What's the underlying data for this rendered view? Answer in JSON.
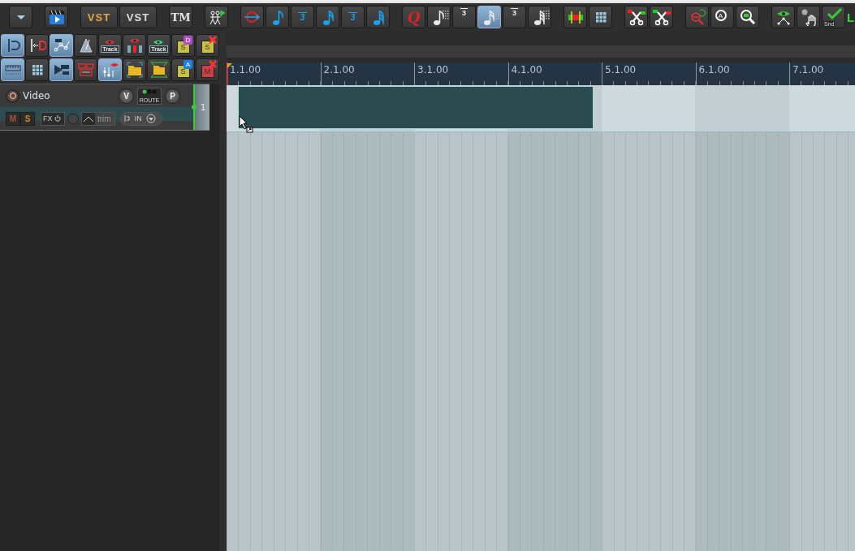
{
  "top_toolbar": {
    "groups": [
      [
        {
          "kind": "dropdown",
          "selected": false
        }
      ],
      [
        {
          "kind": "clapper",
          "selected": false
        }
      ],
      [
        {
          "kind": "text",
          "label": "VST",
          "color": "#e8a445",
          "selected": false
        },
        {
          "kind": "text",
          "label": "VST",
          "color": "#dcdcdc",
          "selected": false
        }
      ],
      [
        {
          "kind": "serif-text",
          "label": "TM",
          "color": "#e6e6e6",
          "selected": false
        }
      ],
      [
        {
          "kind": "walkers",
          "selected": false
        }
      ],
      [
        {
          "kind": "q-arrow",
          "selected": false
        },
        {
          "kind": "note",
          "selected": false
        },
        {
          "kind": "triplet",
          "label": "3",
          "selected": false
        },
        {
          "kind": "note16",
          "selected": false
        },
        {
          "kind": "triplet",
          "label": "3",
          "selected": false
        },
        {
          "kind": "note32",
          "selected": false
        }
      ],
      [
        {
          "kind": "q",
          "label": "Q",
          "selected": false
        },
        {
          "kind": "grid-note",
          "selected": false
        },
        {
          "kind": "grid-triplet",
          "label": "3",
          "selected": false
        },
        {
          "kind": "grid-note16",
          "selected": true
        },
        {
          "kind": "grid-triplet",
          "label": "3",
          "selected": false
        },
        {
          "kind": "grid-note32",
          "selected": false
        }
      ],
      [
        {
          "kind": "meter",
          "selected": false
        },
        {
          "kind": "grid",
          "selected": false
        }
      ],
      [
        {
          "kind": "scissors-left",
          "selected": false
        },
        {
          "kind": "scissors-right",
          "selected": false
        }
      ],
      [
        {
          "kind": "zoom-undo",
          "selected": false
        },
        {
          "kind": "zoom-a",
          "label": "A",
          "selected": false
        },
        {
          "kind": "zoom-rect",
          "selected": false
        }
      ],
      [
        {
          "kind": "eye-node",
          "selected": false
        },
        {
          "kind": "hand",
          "selected": false
        },
        {
          "kind": "snd-check",
          "label": "Snd",
          "selected": false
        },
        {
          "kind": "cut-text",
          "label": "L",
          "color": "#3ed13e",
          "selected": false
        }
      ]
    ]
  },
  "left_toolbar": {
    "rows": [
      [
        {
          "kind": "snap",
          "selected": true
        },
        {
          "kind": "magnet",
          "selected": false
        },
        {
          "kind": "envelope",
          "selected": true
        },
        {
          "kind": "metronome",
          "selected": false
        },
        {
          "kind": "eye-track",
          "label": "Track",
          "color": "#e0303a",
          "selected": false
        },
        {
          "kind": "eye-bars",
          "color": "#e0303a",
          "selected": false
        },
        {
          "kind": "eye-track",
          "label": "Track",
          "color": "#3ed67a",
          "selected": false
        },
        {
          "kind": "s-badge",
          "label": "S",
          "badge": "D",
          "color": "#b04cc8",
          "selected": false
        },
        {
          "kind": "s-x",
          "label": "S",
          "selected": false
        }
      ],
      [
        {
          "kind": "ruler",
          "selected": true
        },
        {
          "kind": "grid",
          "selected": false
        },
        {
          "kind": "trim",
          "selected": true
        },
        {
          "kind": "double",
          "selected": false
        },
        {
          "kind": "mixer-eye",
          "selected": true
        },
        {
          "kind": "folder",
          "selected": false
        },
        {
          "kind": "folder-hourglass",
          "selected": false
        },
        {
          "kind": "s-badge",
          "label": "S",
          "badge": "A",
          "color": "#1e7fe8",
          "selected": false
        },
        {
          "kind": "m-x",
          "label": "M",
          "selected": false
        }
      ]
    ]
  },
  "ruler": {
    "measures": [
      "1.1.00",
      "2.1.00",
      "3.1.00",
      "4.1.00",
      "5.1.00",
      "6.1.00",
      "7.1.00"
    ]
  },
  "tracks": [
    {
      "number": "1",
      "name": "Video",
      "selected": true,
      "record_armed": false,
      "volume_knob": "V",
      "route_label": "ROUTE",
      "pan_knob": "P",
      "mute_label": "M",
      "muted": false,
      "solo_label": "S",
      "soloed": false,
      "fx_label": "FX",
      "automation_label": "trim",
      "input_label": "IN"
    }
  ]
}
